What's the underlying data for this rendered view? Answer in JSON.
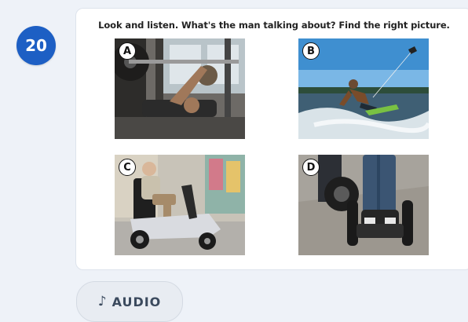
{
  "question": {
    "number": "20",
    "prompt": "Look and listen. What's the man talking about? Find the right picture."
  },
  "options": [
    {
      "label": "A",
      "depicts": "weightlifting-icon"
    },
    {
      "label": "B",
      "depicts": "kitesurfing-icon"
    },
    {
      "label": "C",
      "depicts": "mobility-scooter-icon"
    },
    {
      "label": "D",
      "depicts": "segway-icon"
    }
  ],
  "audio": {
    "icon": "music-note-icon",
    "label": "AUDIO"
  },
  "colors": {
    "badge": "#1d5fc4",
    "background": "#eef2f8",
    "card": "#ffffff",
    "audio_text": "#3b4a5e"
  }
}
